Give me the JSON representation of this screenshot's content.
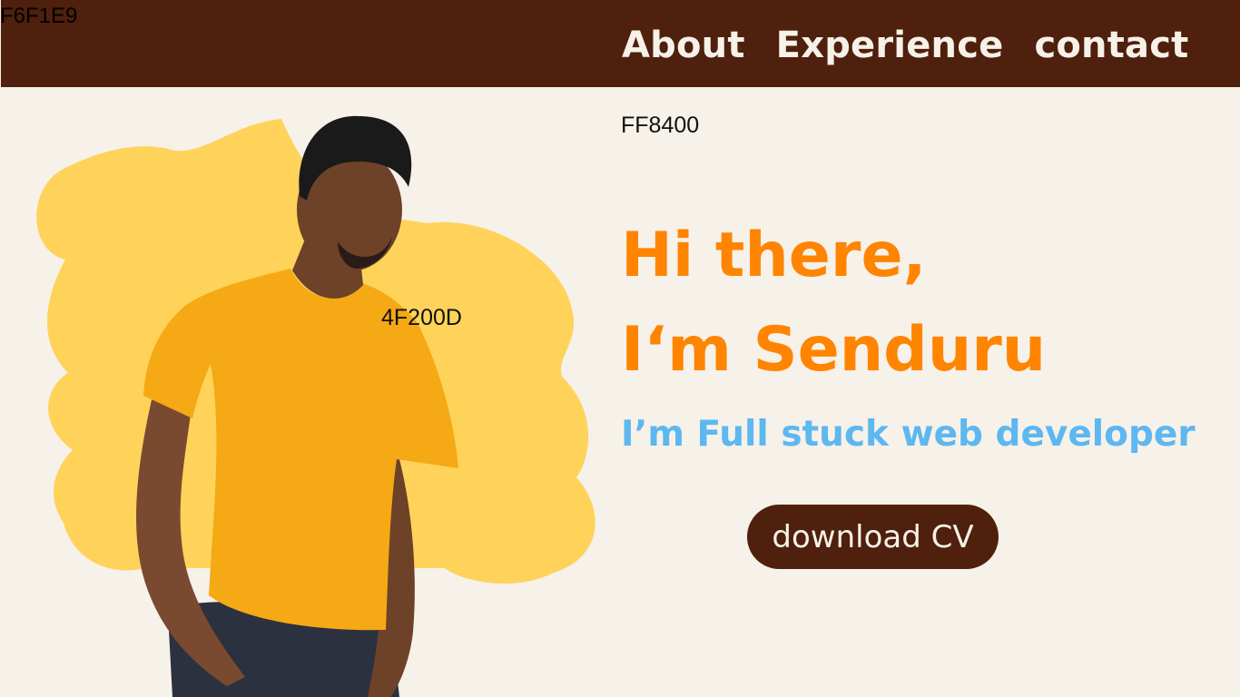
{
  "colors": {
    "background": "#F6F1E9",
    "navbar": "#4F200D",
    "accent_orange": "#FF8400",
    "accent_blue": "#5DB7F0",
    "blob_yellow": "#FFD35A"
  },
  "annotations": {
    "corner": "F6F1E9",
    "orange_code": "FF8400",
    "brown_code": "4F200D"
  },
  "nav": {
    "items": [
      {
        "label": "About"
      },
      {
        "label": "Experience"
      },
      {
        "label": "contact"
      }
    ]
  },
  "hero": {
    "greeting_line1": "Hi there,",
    "greeting_line2": "I‘m Senduru",
    "subtitle": "I’m Full stuck web developer",
    "cta_label": "download CV"
  }
}
